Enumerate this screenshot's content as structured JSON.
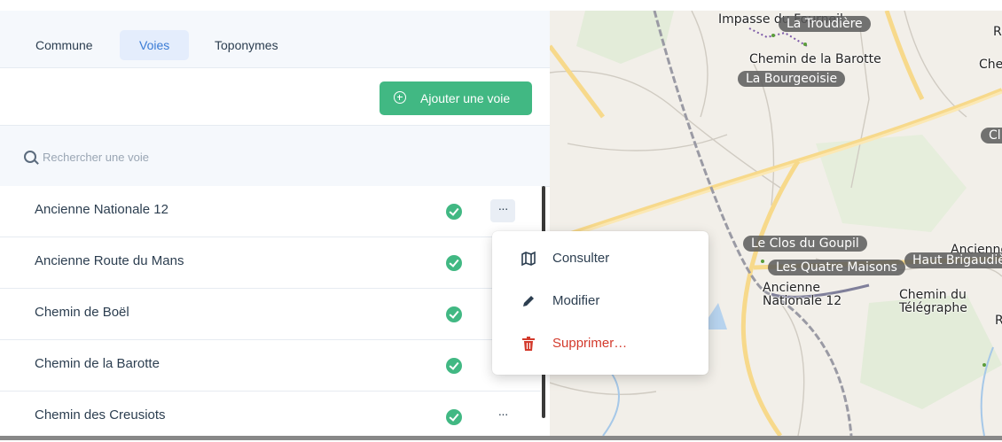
{
  "tabs": [
    {
      "label": "Commune",
      "active": false
    },
    {
      "label": "Voies",
      "active": true
    },
    {
      "label": "Toponymes",
      "active": false
    }
  ],
  "add_button": {
    "label": "Ajouter une voie",
    "icon": "plus-circle-icon",
    "color": "#41b883"
  },
  "search": {
    "placeholder": "Rechercher une voie",
    "value": ""
  },
  "voies": [
    {
      "name": "Ancienne Nationale 12",
      "status": "check-icon",
      "menu_open": true
    },
    {
      "name": "Ancienne Route du Mans",
      "status": "check-icon",
      "menu_open": false
    },
    {
      "name": "Chemin de Boël",
      "status": "check-icon",
      "menu_open": false
    },
    {
      "name": "Chemin de la Barotte",
      "status": "check-icon",
      "menu_open": false
    },
    {
      "name": "Chemin des Creusiots",
      "status": "check-icon",
      "menu_open": false
    }
  ],
  "more_label": "···",
  "menu": {
    "items": [
      {
        "label": "Consulter",
        "icon": "map-icon"
      },
      {
        "label": "Modifier",
        "icon": "pencil-icon"
      },
      {
        "label": "Supprimer…",
        "icon": "trash-icon",
        "color": "#d33a2c"
      }
    ]
  },
  "map": {
    "labels": [
      {
        "text": "Impasse du Fourneil",
        "style": "plain"
      },
      {
        "text": "La Troudière",
        "style": "pill"
      },
      {
        "text": "R",
        "style": "plain"
      },
      {
        "text": "Chemin de la Barotte",
        "style": "plain"
      },
      {
        "text": "Che",
        "style": "plain"
      },
      {
        "text": "La Bourgeoisie",
        "style": "pill"
      },
      {
        "text": "Cl",
        "style": "pill"
      },
      {
        "text": "Le Clos du Goupil",
        "style": "pill"
      },
      {
        "text": "Ancienne",
        "style": "plain"
      },
      {
        "text": "Les Quatre Maisons",
        "style": "pill"
      },
      {
        "text": "Haut Brigaudière",
        "style": "pill"
      },
      {
        "text": "Ancienne Nationale 12",
        "style": "plain"
      },
      {
        "text": "Chemin du Télégraphe",
        "style": "plain"
      },
      {
        "text": "R",
        "style": "plain"
      }
    ]
  },
  "colors": {
    "accent": "#41b883",
    "active_tab": "#3a7bd5",
    "danger": "#d33a2c"
  }
}
